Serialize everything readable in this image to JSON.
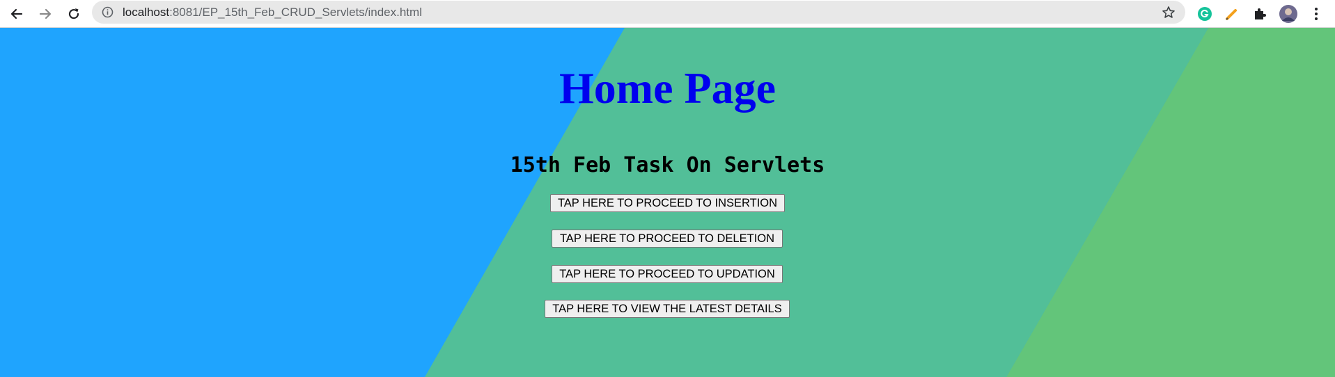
{
  "browser": {
    "url_host": "localhost",
    "url_rest": ":8081/EP_15th_Feb_CRUD_Servlets/index.html"
  },
  "page": {
    "title": "Home Page",
    "subtitle": "15th Feb Task On Servlets",
    "buttons": [
      "TAP HERE TO PROCEED TO INSERTION",
      "TAP HERE TO PROCEED TO DELETION",
      "TAP HERE TO PROCEED TO UPDATION",
      "TAP HERE TO VIEW THE LATEST DETAILS"
    ]
  },
  "colors": {
    "bg_blue": "#1fa4fe",
    "bg_teal": "#52bf98",
    "bg_green": "#63c57a",
    "title": "#0000ee"
  }
}
